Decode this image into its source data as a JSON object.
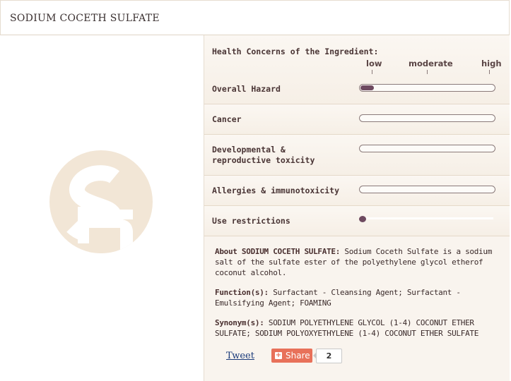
{
  "ingredient": {
    "name": "SODIUM COCETH SULFATE"
  },
  "health": {
    "heading": "Health Concerns of the Ingredient:",
    "scale": {
      "low": "low",
      "moderate": "moderate",
      "high": "high"
    },
    "rows": [
      {
        "label": "Overall Hazard",
        "level": 0.1
      },
      {
        "label": "Cancer",
        "level": 0
      },
      {
        "label_line1": "Developmental &",
        "label_line2": "reproductive toxicity",
        "level": 0
      },
      {
        "label": "Allergies & immunotoxicity",
        "level": 0
      },
      {
        "label": "Use restrictions",
        "level": 0.02
      }
    ]
  },
  "about": {
    "lead": "About SODIUM COCETH SULFATE:",
    "text": "Sodium Coceth Sulfate is a sodium salt of the sulfate ester of the polyethylene glycol etherof coconut alcohol."
  },
  "function": {
    "lead": "Function(s):",
    "text": "Surfactant - Cleansing Agent; Surfactant - Emulsifying Agent; FOAMING"
  },
  "synonyms": {
    "lead": "Synonym(s):",
    "text": "SODIUM POLYETHYLENE GLYCOL (1-4) COCONUT ETHER SULFATE; SODIUM POLYOXYETHYLENE (1-4) COCONUT ETHER SULFATE"
  },
  "social": {
    "tweet_label": "Tweet",
    "share_label": "Share",
    "share_count": "2"
  },
  "colors": {
    "accent": "#6e4a60",
    "share": "#e8715a",
    "logo": "#f2e6d6"
  }
}
